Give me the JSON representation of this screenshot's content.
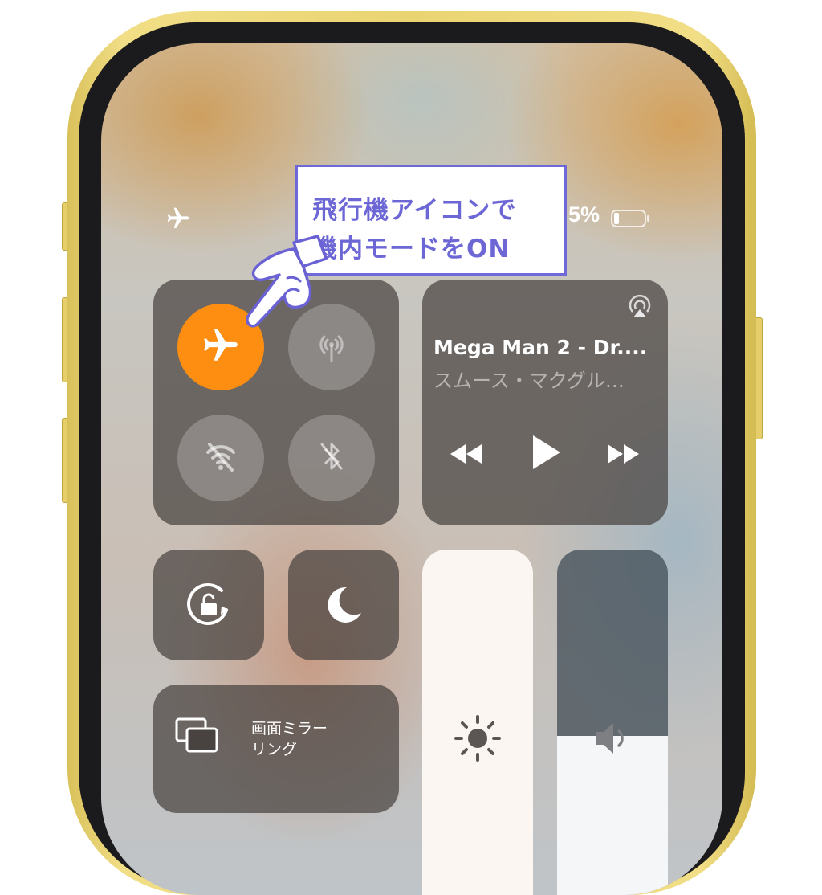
{
  "status_bar": {
    "left_icon": "airplane-icon",
    "battery_percent": "5%",
    "battery_icon": "battery-icon"
  },
  "connectivity": {
    "airplane_mode": {
      "state": "on",
      "icon": "airplane-icon",
      "color": "#fd8e12"
    },
    "cellular_data": {
      "state": "off",
      "icon": "antenna-icon"
    },
    "wifi": {
      "state": "off",
      "icon": "wifi-off-icon"
    },
    "bluetooth": {
      "state": "off",
      "icon": "bluetooth-off-icon"
    }
  },
  "now_playing": {
    "title": "Mega Man 2 - Dr....",
    "artist": "スムース・マクグル…",
    "airplay_icon": "airplay-icon",
    "controls": [
      "rewind-icon",
      "play-icon",
      "fast-forward-icon"
    ]
  },
  "toggles": {
    "rotation_lock": {
      "icon": "rotation-lock-icon"
    },
    "do_not_disturb": {
      "icon": "moon-icon"
    }
  },
  "screen_mirroring": {
    "icon": "screen-mirroring-icon",
    "label_line1": "画面ミラー",
    "label_line2": "リング"
  },
  "brightness": {
    "icon": "sun-icon"
  },
  "volume": {
    "icon": "speaker-icon"
  },
  "callout": {
    "line1": "飛行機アイコンで",
    "line2": "機内モードをON",
    "border_color": "#6f68d8",
    "text_color": "#6d67d6",
    "pointer_icon": "pointing-hand-icon"
  },
  "colors": {
    "frame": "#ead472",
    "accent": "#fd8e12"
  }
}
